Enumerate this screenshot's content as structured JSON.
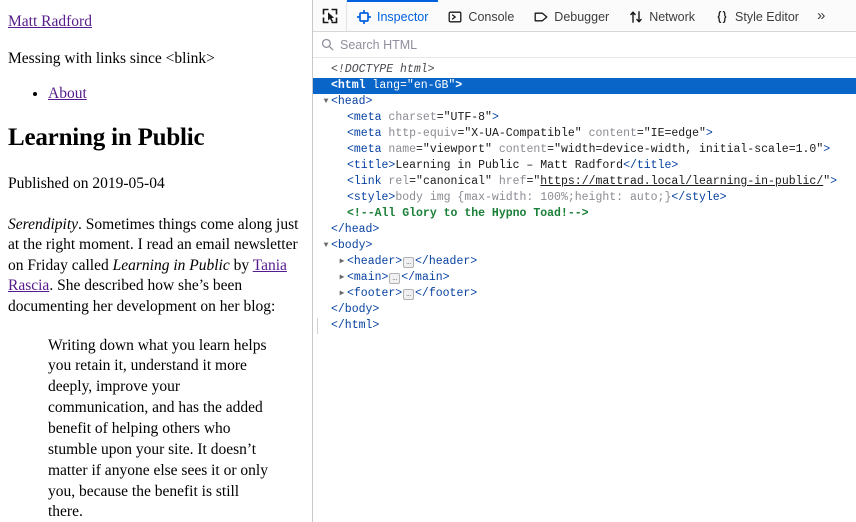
{
  "page": {
    "site_link": "Matt Radford",
    "tagline": "Messing with links since <blink>",
    "nav": [
      {
        "label": "About"
      }
    ],
    "post_title": "Learning in Public",
    "published": "Published on 2019-05-04",
    "lede": {
      "em1": "Serendipity",
      "t1": ". Sometimes things come along just at the right moment. I read an email newsletter on Friday called ",
      "em2": "Learning in Public",
      "t2": " by ",
      "link": "Tania Rascia",
      "t3": ". She described how she’s been documenting her development on her blog:"
    },
    "quote": "Writing down what you learn helps you retain it, understand it more deeply, improve your communication, and has the added benefit of helping others who stumble upon your site. It doesn’t matter if anyone else sees it or only you, because the benefit is still there.",
    "link_color": "#551a8b"
  },
  "devtools": {
    "picker_icon": "element-picker-icon",
    "tabs": [
      {
        "label": "Inspector",
        "icon": "inspector-target-icon",
        "active": true
      },
      {
        "label": "Console",
        "icon": "console-prompt-icon",
        "active": false
      },
      {
        "label": "Debugger",
        "icon": "debugger-pause-icon",
        "active": false
      },
      {
        "label": "Network",
        "icon": "network-arrows-icon",
        "active": false
      },
      {
        "label": "Style Editor",
        "icon": "style-braces-icon",
        "active": false
      }
    ],
    "overflow_label": "»",
    "search": {
      "placeholder": "Search HTML",
      "value": "",
      "icon": "search-icon"
    },
    "accent_color": "#0060df",
    "selection_color": "#0a65c8",
    "nodes": [
      {
        "id": "doctype",
        "indent": 0,
        "twisty": "none",
        "selected": false,
        "parts": [
          {
            "cls": "doctype",
            "t": "<!DOCTYPE html>"
          }
        ]
      },
      {
        "id": "html-open",
        "indent": 0,
        "twisty": "none",
        "selected": true,
        "parts": [
          {
            "cls": "tag",
            "t": "<html "
          },
          {
            "cls": "attr",
            "t": "lang"
          },
          {
            "cls": "val",
            "t": "=\"en-GB\""
          },
          {
            "cls": "tag",
            "t": ">"
          }
        ]
      },
      {
        "id": "head-open",
        "indent": 0,
        "twisty": "open",
        "selected": false,
        "parts": [
          {
            "cls": "tagplain",
            "t": "<head>"
          }
        ]
      },
      {
        "id": "meta-charset",
        "indent": 1,
        "twisty": "none",
        "selected": false,
        "parts": [
          {
            "cls": "tagplain",
            "t": "<meta "
          },
          {
            "cls": "attr",
            "t": "charset"
          },
          {
            "cls": "val",
            "t": "=\"UTF-8\""
          },
          {
            "cls": "tagplain",
            "t": ">"
          }
        ]
      },
      {
        "id": "meta-http-equiv",
        "indent": 1,
        "twisty": "none",
        "selected": false,
        "parts": [
          {
            "cls": "tagplain",
            "t": "<meta "
          },
          {
            "cls": "attr",
            "t": "http-equiv"
          },
          {
            "cls": "val",
            "t": "=\"X-UA-Compatible\" "
          },
          {
            "cls": "attr",
            "t": "content"
          },
          {
            "cls": "val",
            "t": "=\"IE=edge\""
          },
          {
            "cls": "tagplain",
            "t": ">"
          }
        ]
      },
      {
        "id": "meta-viewport",
        "indent": 1,
        "twisty": "none",
        "selected": false,
        "parts": [
          {
            "cls": "tagplain",
            "t": "<meta "
          },
          {
            "cls": "attr",
            "t": "name"
          },
          {
            "cls": "val",
            "t": "=\"viewport\" "
          },
          {
            "cls": "attr",
            "t": "content"
          },
          {
            "cls": "val",
            "t": "=\"width=device-width, initial-scale=1.0\""
          },
          {
            "cls": "tagplain",
            "t": ">"
          }
        ]
      },
      {
        "id": "title",
        "indent": 1,
        "twisty": "none",
        "selected": false,
        "parts": [
          {
            "cls": "tagplain",
            "t": "<title>"
          },
          {
            "cls": "text",
            "t": "Learning in Public – Matt Radford"
          },
          {
            "cls": "tagplain",
            "t": "</title>"
          }
        ]
      },
      {
        "id": "link-canonical",
        "indent": 1,
        "twisty": "none",
        "selected": false,
        "parts": [
          {
            "cls": "tagplain",
            "t": "<link "
          },
          {
            "cls": "attr",
            "t": "rel"
          },
          {
            "cls": "val",
            "t": "=\"canonical\" "
          },
          {
            "cls": "attr",
            "t": "href"
          },
          {
            "cls": "val",
            "t": "=\""
          },
          {
            "cls": "href",
            "t": "https://mattrad.local/learning-in-public/"
          },
          {
            "cls": "val",
            "t": "\""
          },
          {
            "cls": "tagplain",
            "t": ">"
          }
        ]
      },
      {
        "id": "style",
        "indent": 1,
        "twisty": "none",
        "selected": false,
        "parts": [
          {
            "cls": "tagplain",
            "t": "<style>"
          },
          {
            "cls": "attr",
            "t": "body img {max-width: 100%;height: auto;}"
          },
          {
            "cls": "tagplain",
            "t": "</style>"
          }
        ]
      },
      {
        "id": "comment-hypnotoad",
        "indent": 1,
        "twisty": "none",
        "selected": false,
        "parts": [
          {
            "cls": "comment",
            "t": "<!--All Glory to the Hypno Toad!-->"
          }
        ]
      },
      {
        "id": "head-close",
        "indent": 0,
        "twisty": "none",
        "selected": false,
        "parts": [
          {
            "cls": "tagplain",
            "t": "</head>"
          }
        ]
      },
      {
        "id": "body-open",
        "indent": 0,
        "twisty": "open",
        "selected": false,
        "parts": [
          {
            "cls": "tagplain",
            "t": "<body>"
          }
        ]
      },
      {
        "id": "header",
        "indent": 1,
        "twisty": "closed",
        "selected": false,
        "parts": [
          {
            "cls": "tagplain",
            "t": "<header>"
          },
          {
            "cls": "ellipsis",
            "t": "…"
          },
          {
            "cls": "tagplain",
            "t": "</header>"
          }
        ]
      },
      {
        "id": "main",
        "indent": 1,
        "twisty": "closed",
        "selected": false,
        "parts": [
          {
            "cls": "tagplain",
            "t": "<main>"
          },
          {
            "cls": "ellipsis",
            "t": "…"
          },
          {
            "cls": "tagplain",
            "t": "</main>"
          }
        ]
      },
      {
        "id": "footer",
        "indent": 1,
        "twisty": "closed",
        "selected": false,
        "parts": [
          {
            "cls": "tagplain",
            "t": "<footer>"
          },
          {
            "cls": "ellipsis",
            "t": "…"
          },
          {
            "cls": "tagplain",
            "t": "</footer>"
          }
        ]
      },
      {
        "id": "body-close",
        "indent": 0,
        "twisty": "none",
        "selected": false,
        "parts": [
          {
            "cls": "tagplain",
            "t": "</body>"
          }
        ]
      },
      {
        "id": "html-close",
        "indent": -1,
        "twisty": "none",
        "selected": false,
        "guide": true,
        "parts": [
          {
            "cls": "tagplain",
            "t": "</html>"
          }
        ]
      }
    ]
  }
}
